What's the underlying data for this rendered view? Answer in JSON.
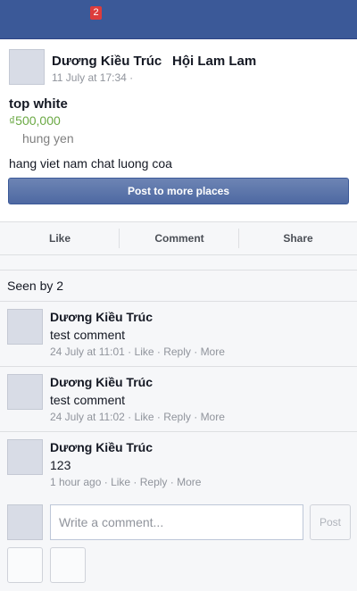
{
  "topbar": {
    "notification_count": "2",
    "color": "#3b5998"
  },
  "post": {
    "author": "Dương Kiều Trúc",
    "group": "Hội Lam Lam",
    "time": "11 July at 17:34 ·",
    "item_title": "top white",
    "price": "₫500,000",
    "location": "hung yen",
    "text": "hang viet nam chat luong coa",
    "post_more_label": "Post to more places"
  },
  "actions": {
    "like": "Like",
    "comment": "Comment",
    "share": "Share"
  },
  "seen_by": "Seen by 2",
  "comments": [
    {
      "author": "Dương Kiều Trúc",
      "text": "test comment",
      "time": "24 July at 11:01",
      "like": "Like",
      "reply": "Reply",
      "more": "More"
    },
    {
      "author": "Dương Kiều Trúc",
      "text": "test comment",
      "time": "24 July at 11:02",
      "like": "Like",
      "reply": "Reply",
      "more": "More"
    },
    {
      "author": "Dương Kiều Trúc",
      "text": "123",
      "time": "1 hour ago",
      "like": "Like",
      "reply": "Reply",
      "more": "More"
    }
  ],
  "composer": {
    "placeholder": "Write a comment...",
    "post_label": "Post"
  },
  "colors": {
    "accent": "#3b5998",
    "price": "#6ba944",
    "badge": "#dd3c3c"
  }
}
